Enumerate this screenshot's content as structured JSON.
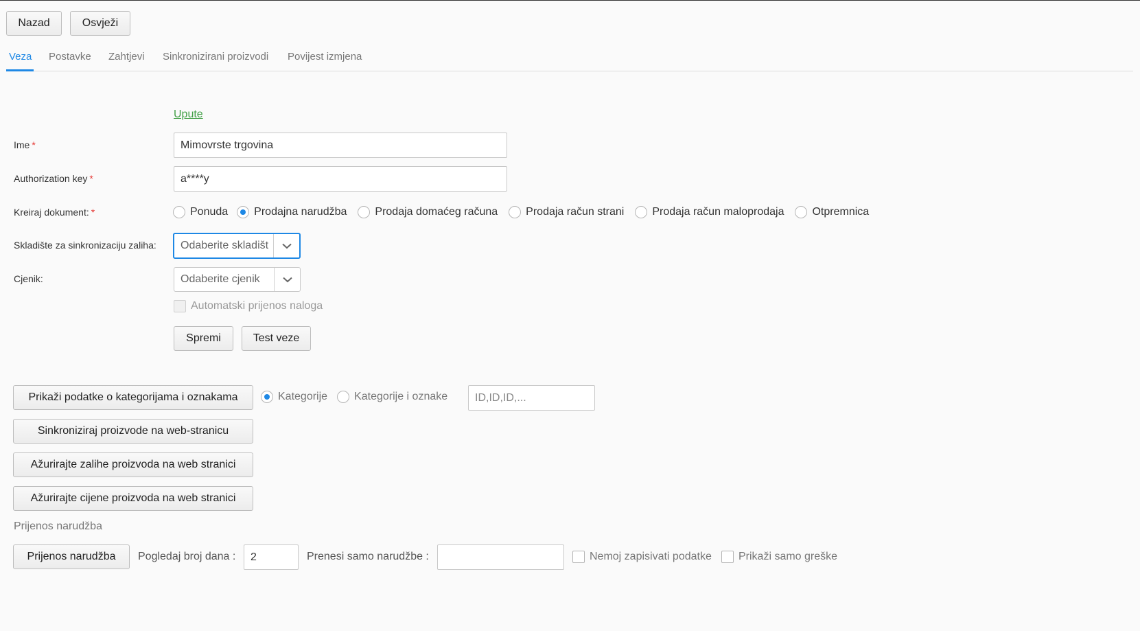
{
  "toolbar": {
    "back_label": "Nazad",
    "refresh_label": "Osvježi"
  },
  "tabs": [
    {
      "label": "Veza",
      "active": true
    },
    {
      "label": "Postavke",
      "active": false
    },
    {
      "label": "Zahtjevi",
      "active": false
    },
    {
      "label": "Sinkronizirani proizvodi",
      "active": false
    },
    {
      "label": "Povijest izmjena",
      "active": false
    }
  ],
  "accent_color": "#1e88e5",
  "link_color": "#43a047",
  "required_color": "#e53935",
  "form": {
    "instructions_link": "Upute",
    "name": {
      "label": "Ime",
      "value": "Mimovrste trgovina"
    },
    "auth_key": {
      "label": "Authorization key",
      "value": "a****y"
    },
    "document": {
      "label": "Kreiraj dokument:",
      "options": [
        "Ponuda",
        "Prodajna narudžba",
        "Prodaja domaćeg računa",
        "Prodaja račun strani",
        "Prodaja račun maloprodaja",
        "Otpremnica"
      ],
      "selected": "Prodajna narudžba"
    },
    "warehouse": {
      "label": "Skladište za sinkronizaciju zaliha:",
      "placeholder": "Odaberite skladišt"
    },
    "pricelist": {
      "label": "Cjenik:",
      "placeholder": "Odaberite cjenik"
    },
    "auto_transfer": {
      "label": "Automatski prijenos naloga",
      "checked": false,
      "disabled": true
    },
    "save_label": "Spremi",
    "test_label": "Test veze"
  },
  "actions": {
    "show_categories_label": "Prikaži podatke o kategorijama i oznakama",
    "category_mode": {
      "options": [
        "Kategorije",
        "Kategorije i oznake"
      ],
      "selected": "Kategorije"
    },
    "ids_placeholder": "ID,ID,ID,...",
    "sync_products_label": "Sinkroniziraj proizvode na web-stranicu",
    "update_stock_label": "Ažurirajte zalihe proizvoda na web stranici",
    "update_prices_label": "Ažurirajte cijene proizvoda na web stranici"
  },
  "order_transfer": {
    "section_title": "Prijenos narudžba",
    "button_label": "Prijenos narudžba",
    "days_label": "Pogledaj broj dana :",
    "days_value": "2",
    "only_orders_label": "Prenesi samo narudžbe :",
    "only_orders_value": "",
    "no_write_label": "Nemoj zapisivati podatke",
    "errors_only_label": "Prikaži samo greške"
  }
}
